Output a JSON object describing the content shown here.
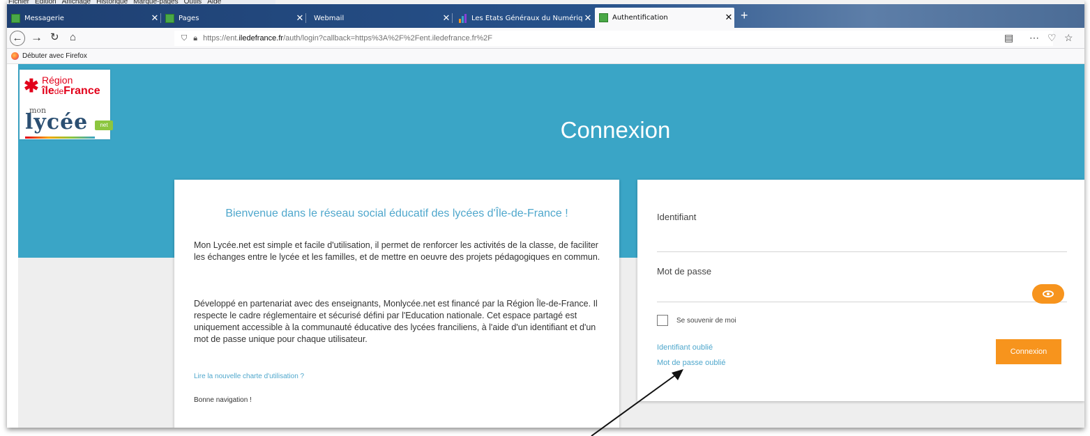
{
  "browser": {
    "menu": [
      "Fichier",
      "Édition",
      "Affichage",
      "Historique",
      "Marque-pages",
      "Outils",
      "Aide"
    ],
    "tabs": [
      {
        "title": "Messagerie",
        "active": false
      },
      {
        "title": "Pages",
        "active": false
      },
      {
        "title": "Webmail",
        "active": false
      },
      {
        "title": "Les États Généraux du Numériq",
        "active": false
      },
      {
        "title": "Authentification",
        "active": true
      }
    ],
    "new_tab": "+",
    "url_prefix": "https://ent.",
    "url_domain": "iledefrance.fr",
    "url_path": "/auth/login?callback=https%3A%2F%2Fent.iledefrance.fr%2F",
    "bookmark": "Débuter avec Firefox"
  },
  "logo": {
    "region_word": "Région",
    "ile": "île",
    "de": "de",
    "france": "France",
    "mon": "mon",
    "lycee": "lycée",
    "net": "net"
  },
  "page": {
    "title": "Connexion"
  },
  "welcome": {
    "heading": "Bienvenue dans le réseau social éducatif des lycées d'Île-de-France !",
    "p1": "Mon Lycée.net est simple et facile d'utilisation, il permet de renforcer les activités de la classe, de faciliter les échanges entre le lycée et les familles, et de mettre en oeuvre des projets pédagogiques en commun.",
    "p2": "Développé en partenariat avec des enseignants, Monlycée.net est financé par la Région Île-de-France. Il respecte le cadre réglementaire et sécurisé défini par l'Education nationale. Cet espace partagé est uniquement accessible à la communauté éducative des lycées franciliens, à l'aide d'un identifiant et d'un mot de passe unique pour chaque utilisateur.",
    "charte_link": "Lire la nouvelle charte d'utilisation ?",
    "closing": "Bonne navigation !"
  },
  "login": {
    "identifiant_label": "Identifiant",
    "identifiant_value": "",
    "password_label": "Mot de passe",
    "password_value": "",
    "remember_label": "Se souvenir de moi",
    "remember_checked": false,
    "forgot_id": "Identifiant oublié",
    "forgot_password": "Mot de passe oublié",
    "submit": "Connexion"
  },
  "colors": {
    "banner": "#3aa5c6",
    "accent_orange": "#f7941d",
    "link_blue": "#4fa7cc",
    "tabstrip": "#27528b"
  },
  "icons": [
    "back-icon",
    "forward-icon",
    "reload-icon",
    "home-icon",
    "shield-icon",
    "lock-icon",
    "reader-view-icon",
    "more-icon",
    "pocket-icon",
    "bookmark-star-icon",
    "eye-icon",
    "annotation-arrow"
  ]
}
